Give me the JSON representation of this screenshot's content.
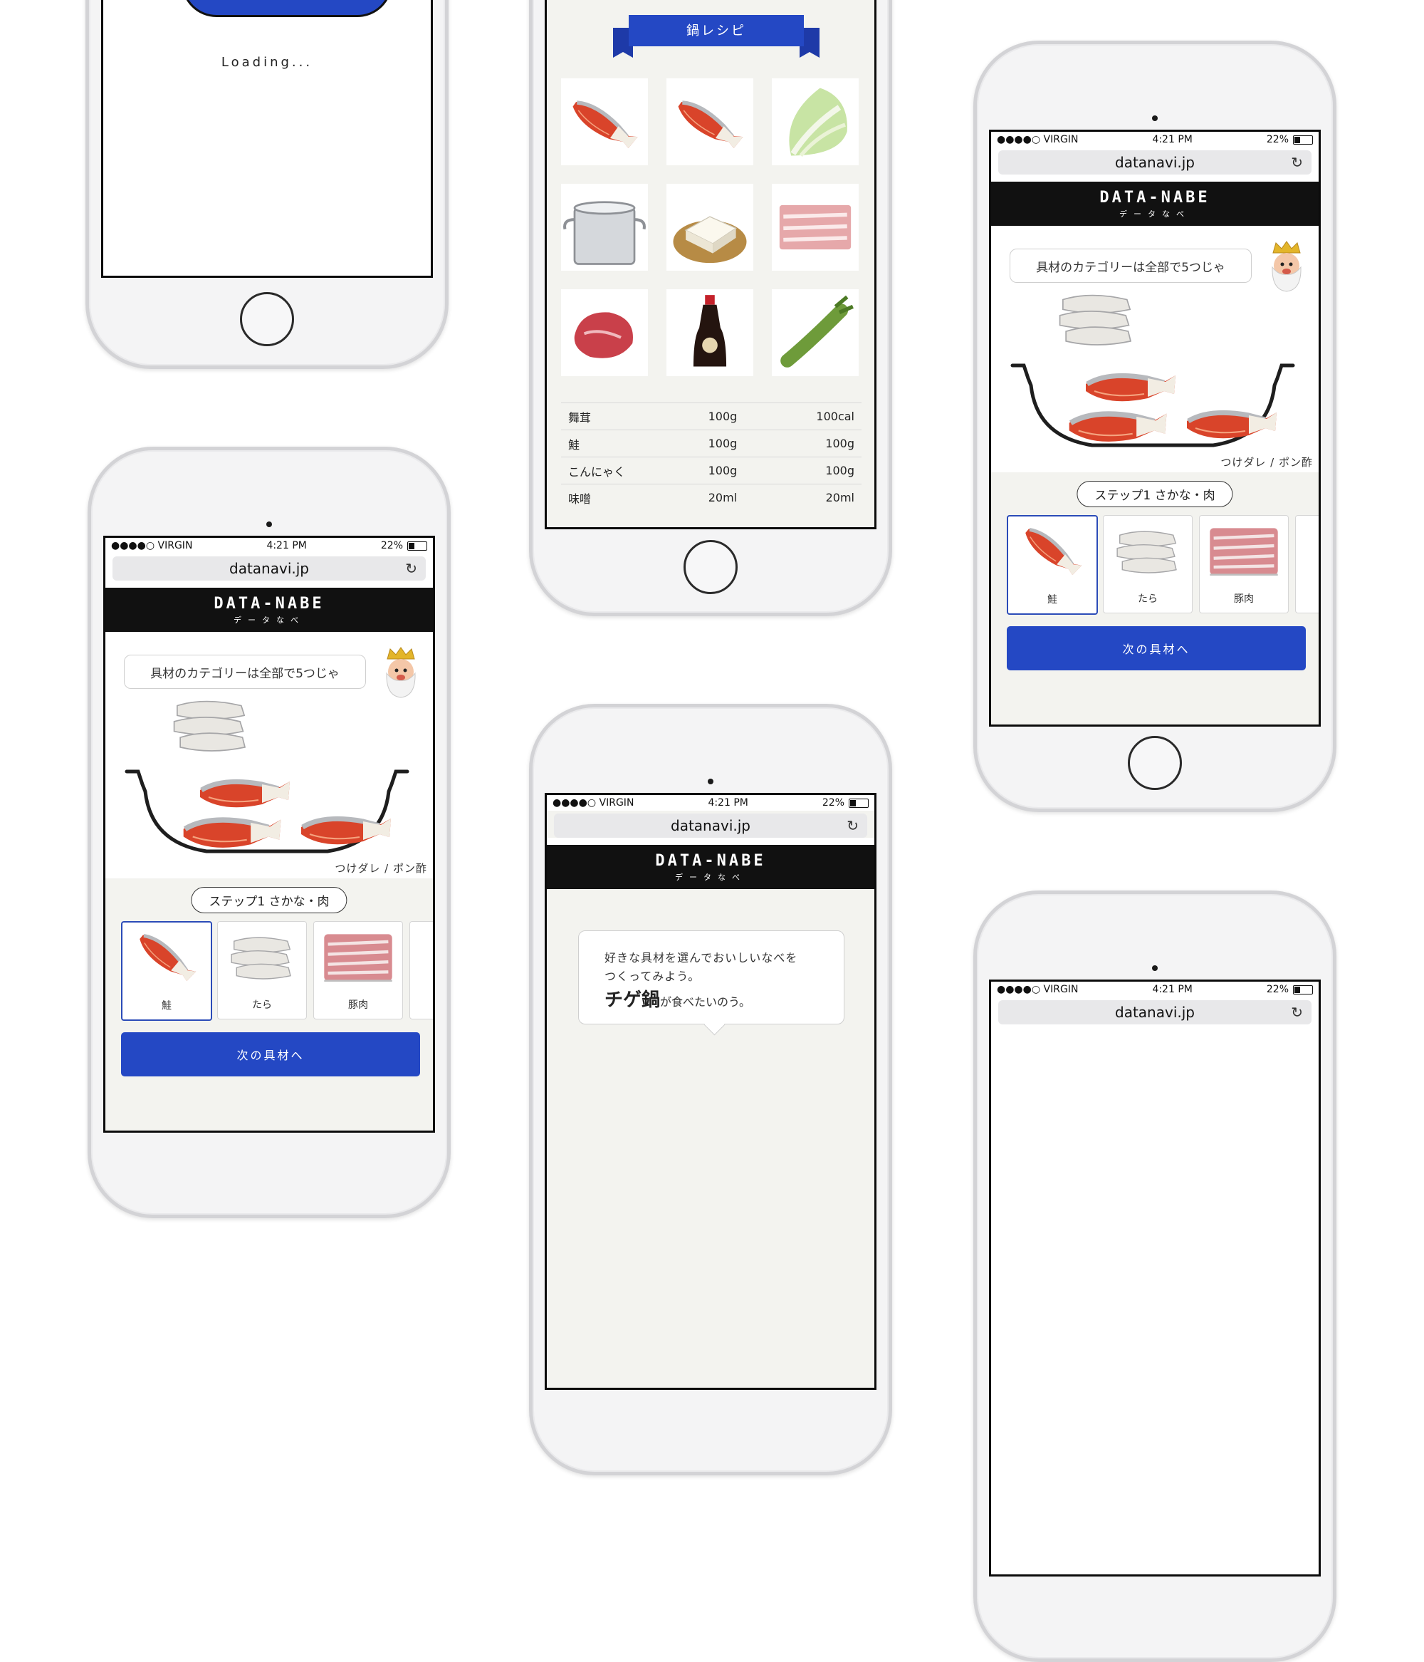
{
  "status": {
    "carrier": "●●●●○ VIRGIN",
    "time": "4:21 PM",
    "battery": "22%"
  },
  "url": "datanavi.jp",
  "brand": {
    "logo": "DATA-NABE",
    "kana": "データなべ"
  },
  "loading": {
    "text": "Loading..."
  },
  "recipe": {
    "title": "鍋レシピ",
    "rows": [
      {
        "name": "舞茸",
        "amount": "100g",
        "calorie": "100cal"
      },
      {
        "name": "鮭",
        "amount": "100g",
        "calorie": "100g"
      },
      {
        "name": "こんにゃく",
        "amount": "100g",
        "calorie": "100g"
      },
      {
        "name": "味噌",
        "amount": "20ml",
        "calorie": "20ml"
      }
    ]
  },
  "select": {
    "speech": "具材のカテゴリーは全部で5つじゃ",
    "sauce": "つけダレ / ポン酢",
    "step": "ステップ1 さかな・肉",
    "items": [
      {
        "label": "鮭"
      },
      {
        "label": "たら"
      },
      {
        "label": "豚肉"
      }
    ],
    "next": "次の具材へ"
  },
  "intro": {
    "line1": "好きな具材を選んでおいしいなべを",
    "line2": "つくってみよう。",
    "dish": "チゲ鍋",
    "suffix": "が食べたいのう。"
  },
  "colors": {
    "accent": "#2448c4",
    "brand_bar": "#111111",
    "salmon": "#e2542f"
  }
}
